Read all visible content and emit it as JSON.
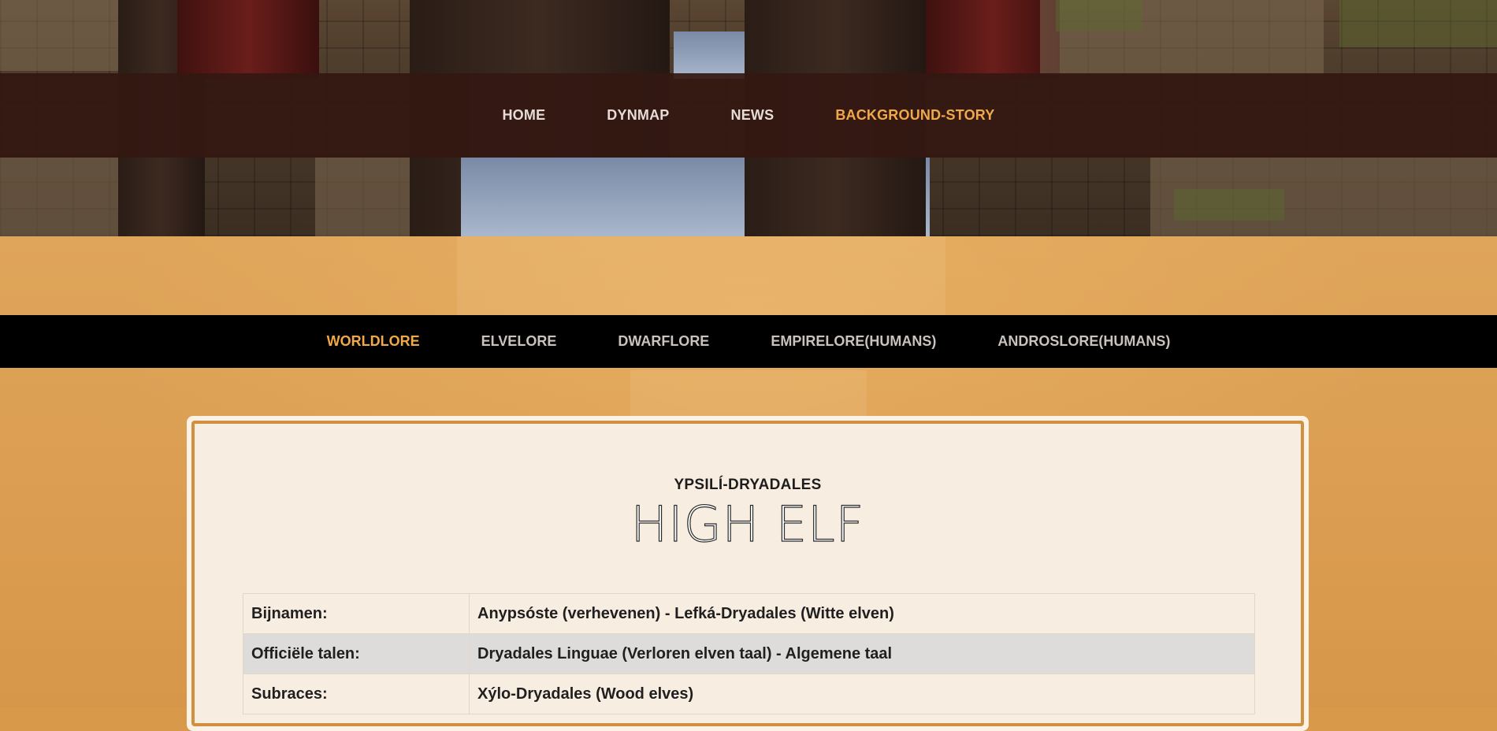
{
  "main_nav": {
    "items": [
      {
        "label": "HOME",
        "active": false
      },
      {
        "label": "DYNMAP",
        "active": false
      },
      {
        "label": "NEWS",
        "active": false
      },
      {
        "label": "BACKGROUND-STORY",
        "active": true
      }
    ]
  },
  "sub_nav": {
    "items": [
      {
        "label": "WORLDLORE",
        "active": true
      },
      {
        "label": "ELVELORE",
        "active": false
      },
      {
        "label": "DWARFLORE",
        "active": false
      },
      {
        "label": "EMPIRELORE(HUMANS)",
        "active": false
      },
      {
        "label": "ANDROSLORE(HUMANS)",
        "active": false
      }
    ]
  },
  "card": {
    "eyebrow": "YPSILÍ-DRYADALES",
    "title": "HIGH ELF",
    "table": [
      {
        "key": "Bijnamen:",
        "value": "Anypsóste (verhevenen) - Lefká-Dryadales (Witte elven)"
      },
      {
        "key": "Officiële talen:",
        "value": "Dryadales Linguae (Verloren elven taal) - Algemene taal"
      },
      {
        "key": "Subraces:",
        "value": "Xýlo-Dryadales (Wood elves)"
      }
    ]
  },
  "colors": {
    "accent": "#f0a848",
    "nav_bg": "#341812",
    "sub_nav_bg": "#000000",
    "orange_band": "#d9994a",
    "card_border": "#d18f40"
  }
}
